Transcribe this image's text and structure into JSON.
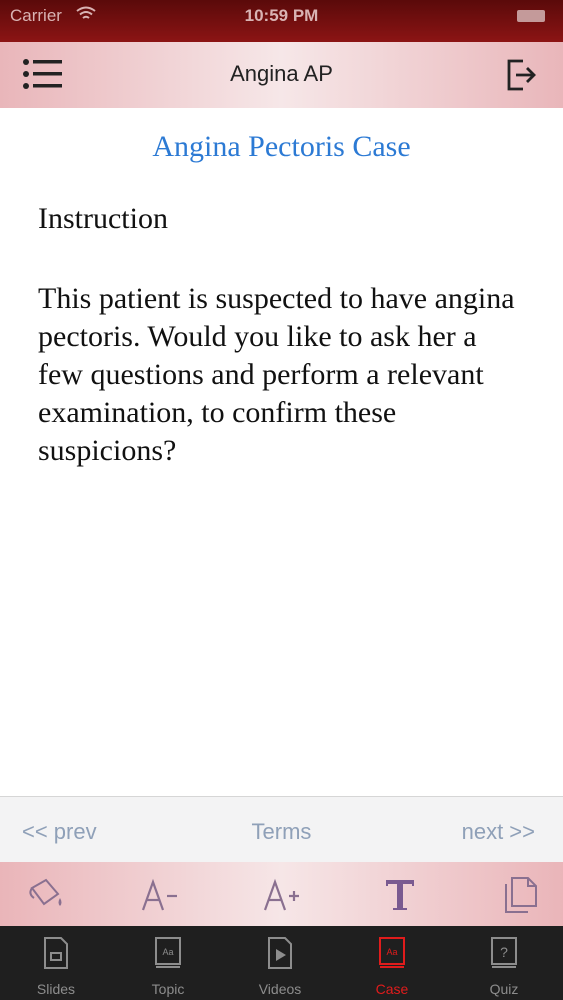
{
  "status_bar": {
    "carrier": "Carrier",
    "time": "10:59 PM"
  },
  "nav": {
    "title": "Angina AP"
  },
  "content": {
    "case_title": "Angina Pectoris Case",
    "instruction_heading": "Instruction",
    "instruction_body": "This patient is suspected to have angina pectoris. Would you like to ask her a few questions and perform a relevant examination, to confirm these suspicions?"
  },
  "pager": {
    "prev": "<< prev",
    "terms": "Terms",
    "next": "next >>"
  },
  "toolbar": {
    "icons": [
      "paint-bucket-icon",
      "decrease-font-icon",
      "increase-font-icon",
      "font-style-icon",
      "copy-icon"
    ]
  },
  "tabs": [
    {
      "label": "Slides",
      "icon": "slides-icon"
    },
    {
      "label": "Topic",
      "icon": "topic-icon"
    },
    {
      "label": "Videos",
      "icon": "videos-icon"
    },
    {
      "label": "Case",
      "icon": "case-icon",
      "active": true
    },
    {
      "label": "Quiz",
      "icon": "quiz-icon"
    }
  ],
  "colors": {
    "accent": "#2c7ad4",
    "active_tab": "#e01c1c",
    "status_bar": "#8c1414"
  }
}
